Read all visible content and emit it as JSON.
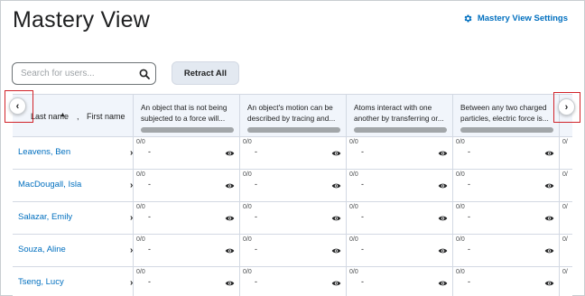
{
  "page": {
    "title": "Mastery View"
  },
  "toolbar": {
    "settings_label": "Mastery View Settings",
    "settings_icon": "gear-icon",
    "search_placeholder": "Search for users...",
    "search_value": "",
    "search_icon": "magnifier-icon",
    "retract_label": "Retract All"
  },
  "colors": {
    "accent": "#006fbf",
    "header_bg": "#f1f5fb",
    "highlight": "#d1232a",
    "bar": "#a2a6a9"
  },
  "table": {
    "name_header": {
      "last": "Last name",
      "sort_indicator": "▲",
      "separator": ",",
      "first": "First name"
    },
    "objectives": [
      {
        "text": "An object that is not being subjected to a force will..."
      },
      {
        "text": "An object's motion can be described by tracing and..."
      },
      {
        "text": "Atoms interact with one another by transferring or..."
      },
      {
        "text": "Between any two charged particles, electric force is..."
      }
    ],
    "rows": [
      {
        "name": "Leavens, Ben",
        "cells": [
          {
            "score": "0/0",
            "level": "-"
          },
          {
            "score": "0/0",
            "level": "-"
          },
          {
            "score": "0/0",
            "level": "-"
          },
          {
            "score": "0/0",
            "level": "-"
          }
        ]
      },
      {
        "name": "MacDougall, Isla",
        "cells": [
          {
            "score": "0/0",
            "level": "-"
          },
          {
            "score": "0/0",
            "level": "-"
          },
          {
            "score": "0/0",
            "level": "-"
          },
          {
            "score": "0/0",
            "level": "-"
          }
        ]
      },
      {
        "name": "Salazar, Emily",
        "cells": [
          {
            "score": "0/0",
            "level": "-"
          },
          {
            "score": "0/0",
            "level": "-"
          },
          {
            "score": "0/0",
            "level": "-"
          },
          {
            "score": "0/0",
            "level": "-"
          }
        ]
      },
      {
        "name": "Souza, Aline",
        "cells": [
          {
            "score": "0/0",
            "level": "-"
          },
          {
            "score": "0/0",
            "level": "-"
          },
          {
            "score": "0/0",
            "level": "-"
          },
          {
            "score": "0/0",
            "level": "-"
          }
        ]
      },
      {
        "name": "Tseng, Lucy",
        "cells": [
          {
            "score": "0/0",
            "level": "-"
          },
          {
            "score": "0/0",
            "level": "-"
          },
          {
            "score": "0/0",
            "level": "-"
          },
          {
            "score": "0/0",
            "level": "-"
          }
        ]
      }
    ],
    "row_expand_glyph": "›",
    "cell_icon": "eye-icon",
    "partial_column_score": "0/"
  },
  "navigation": {
    "prev_glyph": "‹",
    "next_glyph": "›",
    "prev_icon": "chevron-left-icon",
    "next_icon": "chevron-right-icon"
  }
}
